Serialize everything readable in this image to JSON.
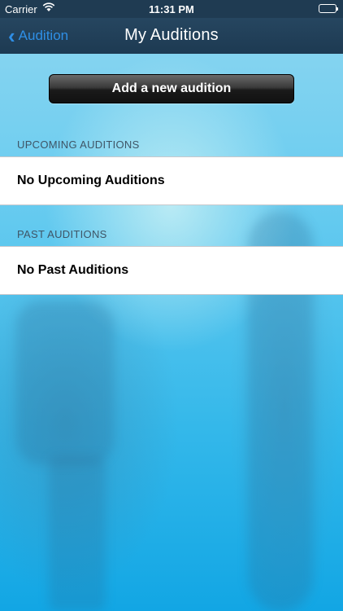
{
  "statusbar": {
    "carrier": "Carrier",
    "time": "11:31 PM",
    "wifi_icon": "wifi-icon",
    "battery_icon": "battery-icon"
  },
  "navbar": {
    "back_label": "Audition",
    "back_icon": "chevron-left-icon",
    "title": "My Auditions"
  },
  "actions": {
    "add_label": "Add a new audition"
  },
  "sections": {
    "upcoming": {
      "header": "UPCOMING AUDITIONS",
      "empty_text": "No Upcoming Auditions"
    },
    "past": {
      "header": "PAST AUDITIONS",
      "empty_text": "No Past Auditions"
    }
  },
  "colors": {
    "navbar": "#1d3a52",
    "accent": "#2f8fe6",
    "background": "#34b8ea"
  }
}
